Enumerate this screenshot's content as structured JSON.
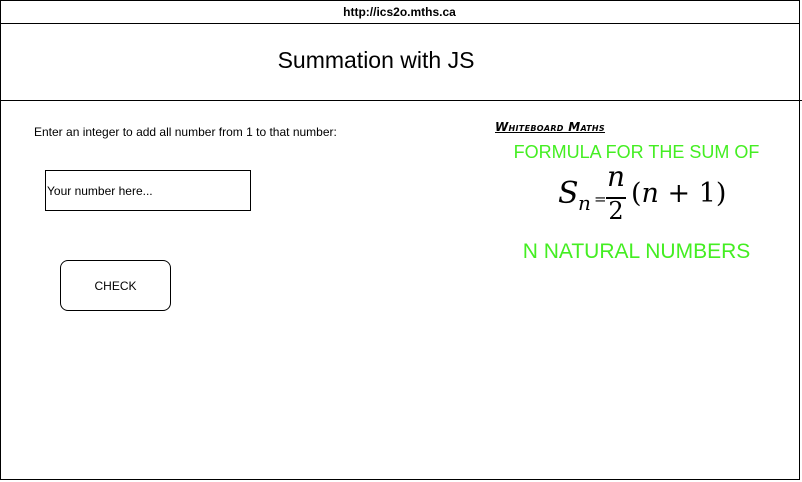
{
  "browser": {
    "url": "http://ics2o.mths.ca"
  },
  "header": {
    "title": "Summation with JS"
  },
  "form": {
    "prompt": "Enter an integer to add all number from 1 to that number:",
    "input_placeholder": "Your number here...",
    "input_value": "",
    "check_label": "CHECK"
  },
  "figure": {
    "brand": "Whiteboard Maths",
    "line_top": "FORMULA FOR THE SUM OF",
    "line_bottom": "N NATURAL NUMBERS",
    "accent_color": "#44ee22",
    "formula": {
      "symbol": "S",
      "subscript": "n",
      "equals": "=",
      "numerator": "n",
      "denominator": "2",
      "paren_open": "(",
      "paren_var": "n",
      "paren_op": " + 1)"
    }
  }
}
